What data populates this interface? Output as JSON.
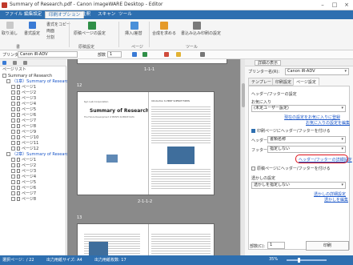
{
  "window": {
    "title": "Summary of Research.pdf - Canon imageWARE Desktop - Editor"
  },
  "menu": {
    "items": [
      "ファイル",
      "編集設定",
      "印刷オプション",
      "注釈",
      "スキャン",
      "ツール"
    ],
    "active_index": 2
  },
  "ribbon": {
    "undo": "取り消し",
    "redo": "やり直し",
    "settings_apply": "書式設定",
    "settings_copy": "書式をコピー",
    "duplex": "両面",
    "split": "分割",
    "page_settings": "原稿ページの設定",
    "insert": "挿入/差替",
    "merge": "合成を求める",
    "print_settings": "書込み込み印刷の設定",
    "group_doc": "書",
    "group_page_settings": "原稿設定",
    "group_edit": "ページ",
    "group_tools": "ツール"
  },
  "toolbar2": {
    "printer_label": "プリンター",
    "printer_value": "Canon iR-ADV",
    "copies_label": "部数",
    "copies_value": "1"
  },
  "left_pane": {
    "header": "ページリスト",
    "root": "Summary of Research",
    "group1": "（1章）Summary of Research",
    "pages": [
      "ページ1",
      "ページ2",
      "ページ3",
      "ページ4",
      "ページ5",
      "ページ6",
      "ページ7",
      "ページ8",
      "ページ9",
      "ページ10",
      "ページ11",
      "ページ12"
    ],
    "group2": "（2章）Summary of Research",
    "pages2": [
      "ページ1",
      "ページ2",
      "ページ3",
      "ページ4",
      "ページ5",
      "ページ6",
      "ページ7",
      "ページ8"
    ]
  },
  "canvas": {
    "page_label_1": "1-1-1",
    "page_num_12": "12",
    "page_label_2": "2-1-1-2",
    "page_num_13": "13",
    "doc_title": "Summary of Research",
    "doc_subtitle": "The Future Development of PRINTS SCIENCE DATA",
    "doc_company": "Kyo Lab Corporation",
    "doc_intro": "Introduction to PRINT SCIENCE FORMS"
  },
  "right_pane": {
    "detail_button": "詳細の表示",
    "printer_name_label": "プリンター名(R):",
    "printer_name_value": "Canon iR-ADV",
    "tabs": [
      "テンプレート",
      "印刷設定",
      "ページ設定"
    ],
    "active_tab": 2,
    "header_footer_title": "ヘッダー/フッターの設定",
    "favorites_label": "お気に入り",
    "favorites_value": "(未定ユーザー設定)",
    "link_save": "現在の設定をお気に入りに登録",
    "link_edit": "お気に入りの設定を編集",
    "checkbox_print_hf": "印刷ページにヘッダー/フッターを付ける",
    "header_label": "ヘッダー:",
    "header_value": "書類名称",
    "footer_label": "フッター:",
    "footer_value": "指定しない",
    "link_detail_hf": "ヘッダー/フッターの詳細設定",
    "checkbox_orig_hf": "原稿ページにヘッダー/フッターを付ける",
    "watermark_title": "透かしの設定",
    "watermark_value": "透かしを指定しない",
    "link_wm_detail": "透かしの詳細設定",
    "link_wm_edit": "透かしを編集",
    "copies_label": "部数(C):",
    "copies_value": "1",
    "print_button": "印刷"
  },
  "status": {
    "selection": "選択ページ：/ 22",
    "paper_size": "出力用紙サイズ: A4",
    "paper_count": "出力用紙枚数: 17",
    "zoom": "35%"
  },
  "colors": {
    "menubar": "#2e6fb0",
    "highlight": "#e0121b",
    "link": "#1a56c8"
  }
}
